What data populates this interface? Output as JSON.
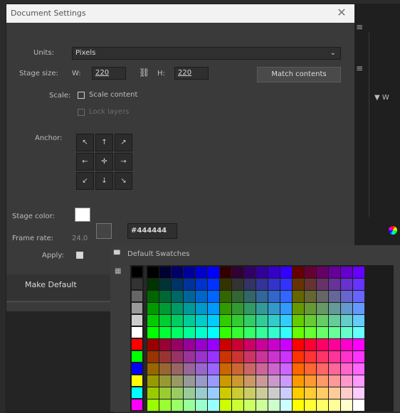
{
  "dialog": {
    "title": "Document Settings",
    "close_label": "✕",
    "units_label": "Units:",
    "units_value": "Pixels",
    "stage_size_label": "Stage size:",
    "width_prefix": "W:",
    "width_value": "220",
    "height_prefix": "H:",
    "height_value": "220",
    "match_contents_label": "Match contents",
    "scale_label": "Scale:",
    "scale_content_label": "Scale content",
    "lock_label": "Lock layers",
    "anchor_label": "Anchor:",
    "anchor_glyphs": [
      "↖",
      "↑",
      "↗",
      "←",
      "✛",
      "→",
      "↙",
      "↓",
      "↘"
    ],
    "stage_color_label": "Stage color:",
    "frame_rate_label": "Frame rate:",
    "frame_rate_value": "24.0",
    "apply_label": "Apply:",
    "make_default_label": "Make Default"
  },
  "right_panel": {
    "menu_icon": "hamburger-icon",
    "vertical_label": "▼ W"
  },
  "color_picker": {
    "hex_value": "#444444",
    "default_swatches_label": "Default Swatches",
    "grayscale": [
      "#000000",
      "#333333",
      "#666666",
      "#999999",
      "#cccccc",
      "#ffffff"
    ],
    "primaries": [
      "#ff0000",
      "#00ff00",
      "#0000ff",
      "#ffff00",
      "#00ffff",
      "#ff00ff"
    ],
    "highlight_color": "#ffffff"
  }
}
